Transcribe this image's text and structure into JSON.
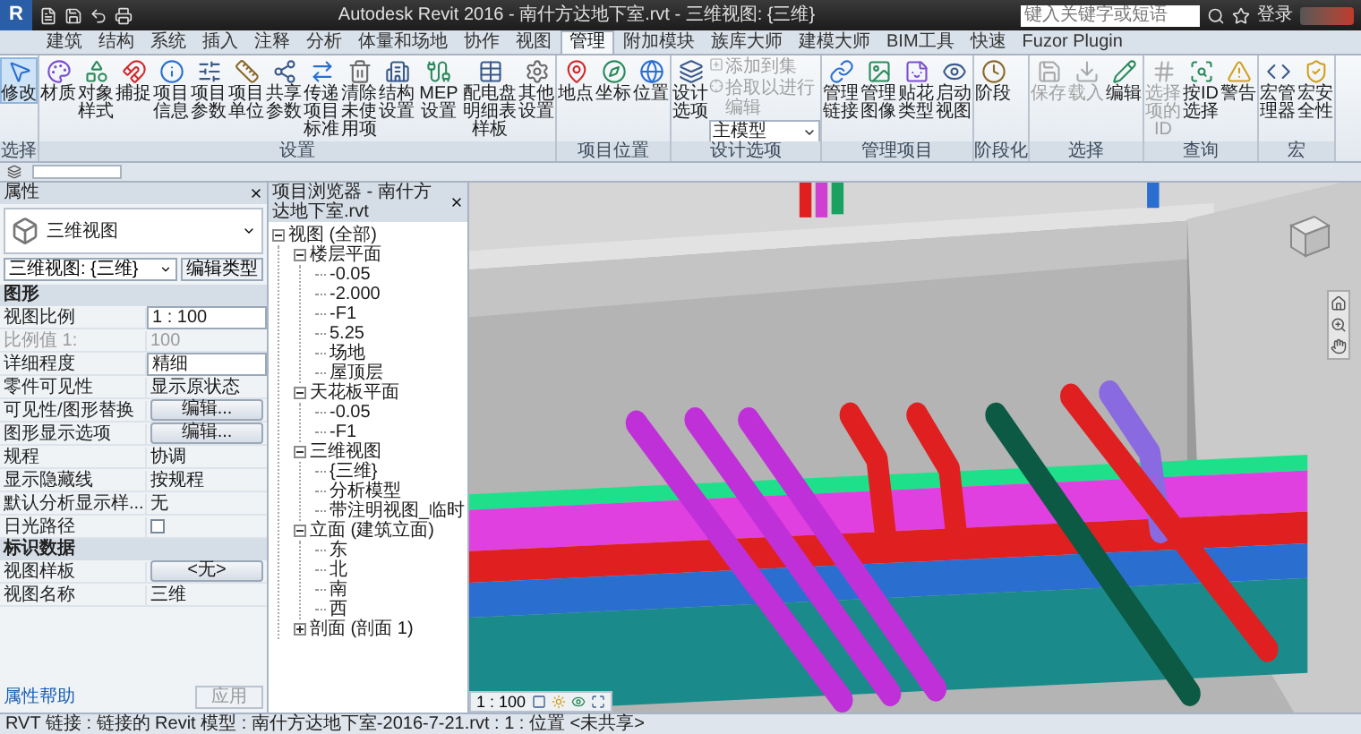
{
  "title_bar": {
    "app_button": "R",
    "title": "Autodesk Revit 2016 - 南什方达地下室.rvt - 三维视图: {三维}",
    "search": {
      "placeholder": "键入关键字或短语"
    },
    "sign_in": "登录"
  },
  "ribbon": {
    "tabs": [
      {
        "label": "建筑",
        "selected": false
      },
      {
        "label": "结构",
        "selected": false
      },
      {
        "label": "系统",
        "selected": false
      },
      {
        "label": "插入",
        "selected": false
      },
      {
        "label": "注释",
        "selected": false
      },
      {
        "label": "分析",
        "selected": false
      },
      {
        "label": "体量和场地",
        "selected": false
      },
      {
        "label": "协作",
        "selected": false
      },
      {
        "label": "视图",
        "selected": false
      },
      {
        "label": "管理",
        "selected": true
      },
      {
        "label": "附加模块",
        "selected": false
      },
      {
        "label": "族库大师",
        "selected": false
      },
      {
        "label": "建模大师",
        "selected": false
      },
      {
        "label": "BIM工具",
        "selected": false
      },
      {
        "label": "快速",
        "selected": false
      },
      {
        "label": "Fuzor Plugin",
        "selected": false
      }
    ],
    "panels": [
      {
        "label": "选择",
        "buttons": [
          {
            "label": "修改",
            "kind": "large",
            "disabled": false,
            "selected": true
          }
        ]
      },
      {
        "label": "设置",
        "buttons": [
          {
            "label": "材质",
            "kind": "large",
            "disabled": false,
            "selected": false
          },
          {
            "label": "对象样式",
            "kind": "large",
            "disabled": false,
            "selected": false
          },
          {
            "label": "捕捉",
            "kind": "large",
            "disabled": false,
            "selected": false
          },
          {
            "label": "项目信息",
            "kind": "large",
            "disabled": false,
            "selected": false
          },
          {
            "label": "项目参数",
            "kind": "large",
            "disabled": false,
            "selected": false
          },
          {
            "label": "项目单位",
            "kind": "large",
            "disabled": false,
            "selected": false
          },
          {
            "label": "共享参数",
            "kind": "large",
            "disabled": false,
            "selected": false
          },
          {
            "label": "传递项目标准",
            "kind": "large",
            "disabled": false,
            "selected": false
          },
          {
            "label": "清除未使用项",
            "kind": "large",
            "disabled": false,
            "selected": false
          },
          {
            "label": "结构设置",
            "kind": "large",
            "disabled": false,
            "selected": false
          },
          {
            "label": "MEP设置",
            "kind": "large",
            "disabled": false,
            "selected": false
          },
          {
            "label": "配电盘明细表样板",
            "kind": "large",
            "disabled": false,
            "selected": false
          },
          {
            "label": "其他设置",
            "kind": "large",
            "disabled": false,
            "selected": false
          }
        ]
      },
      {
        "label": "项目位置",
        "buttons": [
          {
            "label": "地点",
            "kind": "large",
            "disabled": false,
            "selected": false
          },
          {
            "label": "坐标",
            "kind": "large",
            "disabled": false,
            "selected": false
          },
          {
            "label": "位置",
            "kind": "large",
            "disabled": false,
            "selected": false
          }
        ]
      },
      {
        "label": "设计选项",
        "buttons": [
          {
            "label": "设计选项",
            "kind": "large",
            "disabled": false,
            "selected": false
          },
          {
            "label": "添加到集",
            "kind": "small",
            "disabled": true,
            "selected": false
          },
          {
            "label": "拾取以进行编辑",
            "kind": "small",
            "disabled": true,
            "selected": false
          },
          {
            "label": "主模型",
            "kind": "combo",
            "disabled": false,
            "selected": false
          }
        ]
      },
      {
        "label": "管理项目",
        "buttons": [
          {
            "label": "管理链接",
            "kind": "large",
            "disabled": false,
            "selected": false
          },
          {
            "label": "管理图像",
            "kind": "large",
            "disabled": false,
            "selected": false
          },
          {
            "label": "贴花类型",
            "kind": "large",
            "disabled": false,
            "selected": false
          },
          {
            "label": "启动视图",
            "kind": "large",
            "disabled": false,
            "selected": false
          }
        ]
      },
      {
        "label": "阶段化",
        "buttons": [
          {
            "label": "阶段",
            "kind": "large",
            "disabled": false,
            "selected": false
          }
        ]
      },
      {
        "label": "选择",
        "buttons": [
          {
            "label": "保存",
            "kind": "large",
            "disabled": true,
            "selected": false
          },
          {
            "label": "载入",
            "kind": "large",
            "disabled": true,
            "selected": false
          },
          {
            "label": "编辑",
            "kind": "large",
            "disabled": false,
            "selected": false
          }
        ]
      },
      {
        "label": "查询",
        "buttons": [
          {
            "label": "选择项的ID",
            "kind": "large",
            "disabled": true,
            "selected": false
          },
          {
            "label": "按ID选择",
            "kind": "large",
            "disabled": false,
            "selected": false
          },
          {
            "label": "警告",
            "kind": "large",
            "disabled": false,
            "selected": false
          }
        ]
      },
      {
        "label": "宏",
        "buttons": [
          {
            "label": "宏管理器",
            "kind": "large",
            "disabled": false,
            "selected": false
          },
          {
            "label": "宏安全性",
            "kind": "large",
            "disabled": false,
            "selected": false
          }
        ]
      }
    ]
  },
  "properties": {
    "title": "属性",
    "type_name": "三维视图",
    "view_selector": "三维视图: {三维}",
    "edit_type": "编辑类型",
    "groups": [
      {
        "label": "图形",
        "rows": [
          {
            "label": "视图比例",
            "value": "1 : 100",
            "kind": "field",
            "disabled": false
          },
          {
            "label": "比例值 1:",
            "value": "100",
            "kind": "text",
            "disabled": true
          },
          {
            "label": "详细程度",
            "value": "精细",
            "kind": "field",
            "disabled": false
          },
          {
            "label": "零件可见性",
            "value": "显示原状态",
            "kind": "text",
            "disabled": false
          },
          {
            "label": "可见性/图形替换",
            "value": "编辑...",
            "kind": "button",
            "disabled": false
          },
          {
            "label": "图形显示选项",
            "value": "编辑...",
            "kind": "button",
            "disabled": false
          },
          {
            "label": "规程",
            "value": "协调",
            "kind": "text",
            "disabled": false
          },
          {
            "label": "显示隐藏线",
            "value": "按规程",
            "kind": "text",
            "disabled": false
          },
          {
            "label": "默认分析显示样...",
            "value": "无",
            "kind": "text",
            "disabled": false
          },
          {
            "label": "日光路径",
            "kind": "checkbox",
            "checked": false,
            "disabled": false
          }
        ]
      },
      {
        "label": "标识数据",
        "rows": [
          {
            "label": "视图样板",
            "value": "<无>",
            "kind": "button",
            "disabled": false
          },
          {
            "label": "视图名称",
            "value": "三维",
            "kind": "text",
            "disabled": false
          }
        ]
      }
    ],
    "help_link": "属性帮助",
    "apply_button": "应用"
  },
  "project_browser": {
    "title": "项目浏览器 - 南什方达地下室.rvt",
    "tree": [
      {
        "label": "视图 (全部)",
        "expanded": true,
        "children": [
          {
            "label": "楼层平面",
            "expanded": true,
            "children": [
              {
                "label": "-0.05"
              },
              {
                "label": "-2.000"
              },
              {
                "label": "-F1"
              },
              {
                "label": "5.25"
              },
              {
                "label": "场地"
              },
              {
                "label": "屋顶层"
              }
            ]
          },
          {
            "label": "天花板平面",
            "expanded": true,
            "children": [
              {
                "label": "-0.05"
              },
              {
                "label": "-F1"
              }
            ]
          },
          {
            "label": "三维视图",
            "expanded": true,
            "children": [
              {
                "label": "{三维}"
              },
              {
                "label": "分析模型"
              },
              {
                "label": "带注明视图_临时"
              }
            ]
          },
          {
            "label": "立面 (建筑立面)",
            "expanded": true,
            "children": [
              {
                "label": "东"
              },
              {
                "label": "北"
              },
              {
                "label": "南"
              },
              {
                "label": "西"
              }
            ]
          },
          {
            "label": "剖面 (剖面 1)",
            "expanded": false
          }
        ]
      }
    ]
  },
  "view_control_bar": {
    "scale": "1 : 100"
  },
  "status_bar": {
    "text": "RVT 链接 : 链接的 Revit 模型 : 南什方达地下室-2016-7-21.rvt : 1 : 位置 <未共享>"
  }
}
